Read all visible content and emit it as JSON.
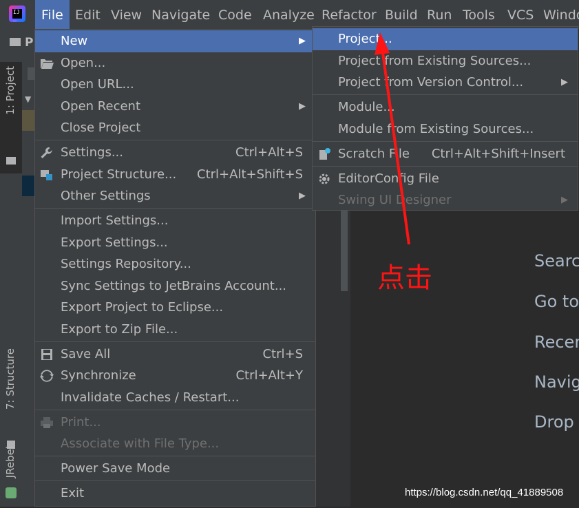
{
  "menubar": {
    "items": [
      "File",
      "Edit",
      "View",
      "Navigate",
      "Code",
      "Analyze",
      "Refactor",
      "Build",
      "Run",
      "Tools",
      "VCS",
      "Windo"
    ]
  },
  "tool_stripe": {
    "project_tab": "1: Project",
    "structure_tab": "7: Structure",
    "jrebel_tab": "JRebel"
  },
  "file_menu": {
    "items": [
      {
        "label": "New",
        "shortcut": "",
        "submenu": true
      },
      {
        "label": "Open...",
        "shortcut": ""
      },
      {
        "label": "Open URL...",
        "shortcut": ""
      },
      {
        "label": "Open Recent",
        "shortcut": "",
        "submenu": true
      },
      {
        "label": "Close Project",
        "shortcut": ""
      },
      {
        "label": "Settings...",
        "shortcut": "Ctrl+Alt+S"
      },
      {
        "label": "Project Structure...",
        "shortcut": "Ctrl+Alt+Shift+S"
      },
      {
        "label": "Other Settings",
        "shortcut": "",
        "submenu": true
      },
      {
        "label": "Import Settings...",
        "shortcut": ""
      },
      {
        "label": "Export Settings...",
        "shortcut": ""
      },
      {
        "label": "Settings Repository...",
        "shortcut": ""
      },
      {
        "label": "Sync Settings to JetBrains Account...",
        "shortcut": ""
      },
      {
        "label": "Export Project to Eclipse...",
        "shortcut": ""
      },
      {
        "label": "Export to Zip File...",
        "shortcut": ""
      },
      {
        "label": "Save All",
        "shortcut": "Ctrl+S"
      },
      {
        "label": "Synchronize",
        "shortcut": "Ctrl+Alt+Y"
      },
      {
        "label": "Invalidate Caches / Restart...",
        "shortcut": ""
      },
      {
        "label": "Print...",
        "shortcut": "",
        "disabled": true
      },
      {
        "label": "Associate with File Type...",
        "shortcut": "",
        "disabled": true
      },
      {
        "label": "Power Save Mode",
        "shortcut": ""
      },
      {
        "label": "Exit",
        "shortcut": ""
      }
    ]
  },
  "new_menu": {
    "items": [
      {
        "label": "Project...",
        "shortcut": ""
      },
      {
        "label": "Project from Existing Sources...",
        "shortcut": ""
      },
      {
        "label": "Project from Version Control...",
        "shortcut": "",
        "submenu": true
      },
      {
        "label": "Module...",
        "shortcut": ""
      },
      {
        "label": "Module from Existing Sources...",
        "shortcut": ""
      },
      {
        "label": "Scratch File",
        "shortcut": "Ctrl+Alt+Shift+Insert"
      },
      {
        "label": "EditorConfig File",
        "shortcut": ""
      },
      {
        "label": "Swing UI Designer",
        "shortcut": "",
        "submenu": true,
        "disabled": true
      }
    ]
  },
  "welcome": {
    "items": [
      "Search",
      "Go to",
      "Recen",
      "Navig",
      "Drop"
    ]
  },
  "annotation": {
    "text": "点击",
    "color": "#ff1414"
  },
  "watermark": "https://blog.csdn.net/qq_41889508",
  "colors": {
    "menu_bg": "#3c3f41",
    "selected": "#4b6eaf",
    "editor_bg": "#2b2b2b"
  }
}
